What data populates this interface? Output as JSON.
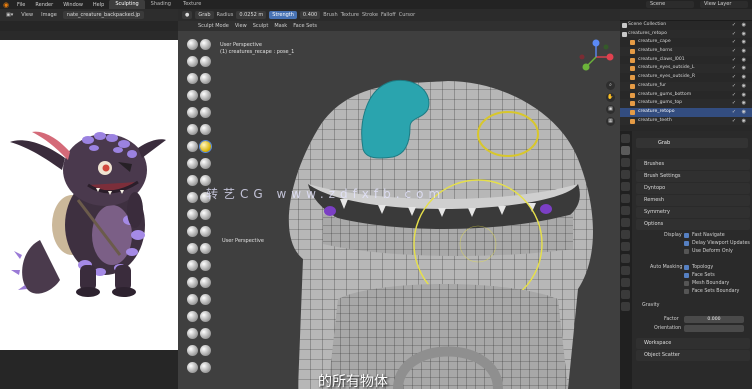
{
  "topbar": {
    "menus": [
      "File",
      "Render",
      "Window",
      "Help"
    ],
    "workspaces": [
      "Sculpting",
      "Shading",
      "Texture"
    ],
    "active_workspace": "Sculpting",
    "scene": "Scene",
    "view_layer": "View Layer"
  },
  "image_editor": {
    "view": "View",
    "image": "Image",
    "filename": "nate_creature_backpacked.jp"
  },
  "viewport": {
    "brush_name": "Grab",
    "radius_label": "Radius",
    "radius_value": "0.0252 m",
    "strength_label": "Strength",
    "strength_value": "0.400",
    "menus": [
      "Brush",
      "Texture",
      "Stroke",
      "Falloff",
      "Cursor"
    ],
    "sub_menus": [
      "Sculpt Mode",
      "View",
      "Sculpt",
      "Mask",
      "Face Sets"
    ],
    "view_name": "User Perspective",
    "object_info": "(1) creatures_recape : pose_1",
    "info2": "User Perspective",
    "subtitle": "的所有物体",
    "watermark": "转艺CG  www.zdfxfb.com"
  },
  "outliner": {
    "rows": [
      {
        "label": "Scene Collection",
        "top": true
      },
      {
        "label": "creatures_retopo",
        "top": true
      },
      {
        "label": "creature_cape"
      },
      {
        "label": "creature_horns"
      },
      {
        "label": "creature_claws_l001"
      },
      {
        "label": "creature_eyes_outside_L"
      },
      {
        "label": "creature_eyes_outside_R"
      },
      {
        "label": "creature_fur"
      },
      {
        "label": "creature_gums_bottom"
      },
      {
        "label": "creature_gums_top"
      },
      {
        "label": "creature_retopo",
        "selected": true
      },
      {
        "label": "creature_teeth"
      }
    ]
  },
  "properties": {
    "brush_field": "Grab",
    "sections": [
      "Brushes",
      "Brush Settings",
      "Dyntopo",
      "Remesh",
      "Symmetry",
      "Options"
    ],
    "display_label": "Display",
    "display_options": [
      {
        "label": "Fast Navigate",
        "checked": true
      },
      {
        "label": "Delay Viewport Updates",
        "checked": true
      },
      {
        "label": "Use Deform Only",
        "checked": false
      }
    ],
    "auto_masking_label": "Auto Masking",
    "auto_masking_options": [
      {
        "label": "Topology",
        "checked": true
      },
      {
        "label": "Face Sets",
        "checked": true
      },
      {
        "label": "Mesh Boundary",
        "checked": false
      },
      {
        "label": "Face Sets Boundary",
        "checked": false
      }
    ],
    "gravity_label": "Gravity",
    "factor_label": "Factor",
    "factor_value": "0.000",
    "orientation_label": "Orientation",
    "bottom_sections": [
      "Workspace",
      "Object Scatter"
    ]
  }
}
